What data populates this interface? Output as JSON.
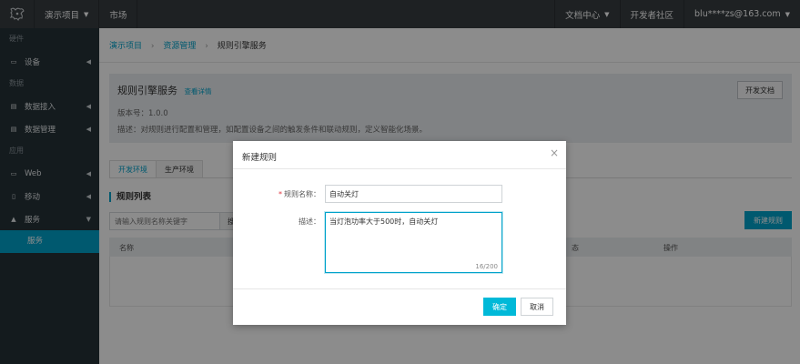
{
  "topbar": {
    "logo_icon": "dragon-logo-icon",
    "project_menu": "演示项目",
    "market": "市场",
    "docs_center": "文档中心",
    "dev_community": "开发者社区",
    "user": "blu****zs@163.com"
  },
  "sidebar": {
    "sections": {
      "hardware": "硬件",
      "data": "数据",
      "app": "应用"
    },
    "items": {
      "device": "设备",
      "data_access": "数据接入",
      "data_manage": "数据管理",
      "web": "Web",
      "mobile": "移动",
      "service": "服务",
      "service_sub": "服务"
    }
  },
  "breadcrumb": {
    "project": "演示项目",
    "resources": "资源管理",
    "current": "规则引擎服务",
    "separator": "›"
  },
  "info": {
    "title": "规则引擎服务",
    "detail_link": "查看详情",
    "version": "版本号：1.0.0",
    "description": "描述：对规则进行配置和管理，如配置设备之间的触发条件和联动规则，定义智能化场景。",
    "dev_doc_button": "开发文档"
  },
  "tabs": {
    "dev": "开发环境",
    "prod": "生产环境"
  },
  "rules": {
    "list_title": "规则列表",
    "search_placeholder": "请输入规则名称关键字",
    "search_button": "搜",
    "new_rule_button": "新建规则",
    "columns": {
      "name": "名称",
      "status": "态",
      "action": "操作"
    }
  },
  "modal": {
    "title": "新建规则",
    "close_glyph": "×",
    "required_mark": "*",
    "name_label": "规则名称：",
    "name_value": "自动关灯",
    "desc_label": "描述：",
    "desc_value": "当灯泡功率大于500时，自动关灯",
    "desc_count": "16/200",
    "ok_button": "确定",
    "cancel_button": "取消"
  },
  "colors": {
    "accent": "#00a2ca",
    "topbar": "#373d41",
    "sidebar": "#263238"
  }
}
